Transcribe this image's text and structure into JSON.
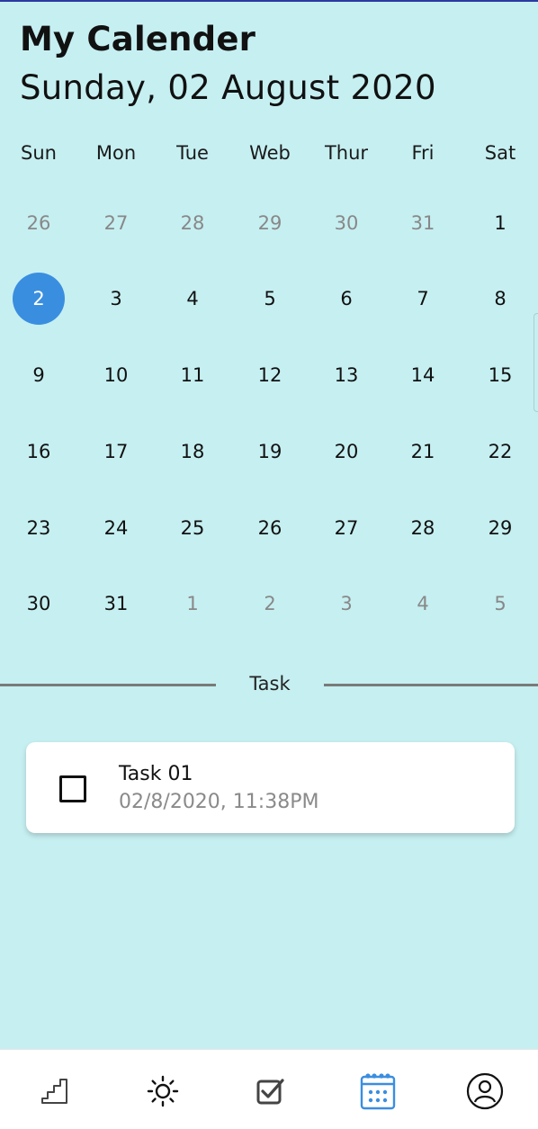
{
  "app": {
    "title": "My Calender",
    "date_heading": "Sunday, 02 August 2020"
  },
  "calendar": {
    "weekdays": [
      "Sun",
      "Mon",
      "Tue",
      "Web",
      "Thur",
      "Fri",
      "Sat"
    ],
    "weeks": [
      [
        {
          "d": "26",
          "other": true
        },
        {
          "d": "27",
          "other": true
        },
        {
          "d": "28",
          "other": true
        },
        {
          "d": "29",
          "other": true
        },
        {
          "d": "30",
          "other": true
        },
        {
          "d": "31",
          "other": true
        },
        {
          "d": "1",
          "other": false
        }
      ],
      [
        {
          "d": "2",
          "other": false,
          "selected": true
        },
        {
          "d": "3",
          "other": false
        },
        {
          "d": "4",
          "other": false
        },
        {
          "d": "5",
          "other": false
        },
        {
          "d": "6",
          "other": false
        },
        {
          "d": "7",
          "other": false
        },
        {
          "d": "8",
          "other": false
        }
      ],
      [
        {
          "d": "9",
          "other": false
        },
        {
          "d": "10",
          "other": false
        },
        {
          "d": "11",
          "other": false
        },
        {
          "d": "12",
          "other": false
        },
        {
          "d": "13",
          "other": false
        },
        {
          "d": "14",
          "other": false
        },
        {
          "d": "15",
          "other": false
        }
      ],
      [
        {
          "d": "16",
          "other": false
        },
        {
          "d": "17",
          "other": false
        },
        {
          "d": "18",
          "other": false
        },
        {
          "d": "19",
          "other": false
        },
        {
          "d": "20",
          "other": false
        },
        {
          "d": "21",
          "other": false
        },
        {
          "d": "22",
          "other": false
        }
      ],
      [
        {
          "d": "23",
          "other": false
        },
        {
          "d": "24",
          "other": false
        },
        {
          "d": "25",
          "other": false
        },
        {
          "d": "26",
          "other": false
        },
        {
          "d": "27",
          "other": false
        },
        {
          "d": "28",
          "other": false
        },
        {
          "d": "29",
          "other": false
        }
      ],
      [
        {
          "d": "30",
          "other": false
        },
        {
          "d": "31",
          "other": false
        },
        {
          "d": "1",
          "other": true
        },
        {
          "d": "2",
          "other": true
        },
        {
          "d": "3",
          "other": true
        },
        {
          "d": "4",
          "other": true
        },
        {
          "d": "5",
          "other": true
        }
      ]
    ],
    "selected_color": "#3a8ee0"
  },
  "tasks": {
    "section_label": "Task",
    "items": [
      {
        "title": "Task 01",
        "datetime": "02/8/2020, 11:38PM",
        "checked": false
      }
    ]
  },
  "navbar": {
    "items": [
      {
        "icon": "stairs-icon",
        "active": false
      },
      {
        "icon": "sun-icon",
        "active": false
      },
      {
        "icon": "checkbox-icon",
        "active": false
      },
      {
        "icon": "calendar-icon",
        "active": true
      },
      {
        "icon": "user-icon",
        "active": false
      }
    ],
    "active_color": "#3a8ee0",
    "inactive_color": "#333333"
  },
  "colors": {
    "background": "#c6eff1",
    "accent": "#3a8ee0"
  }
}
